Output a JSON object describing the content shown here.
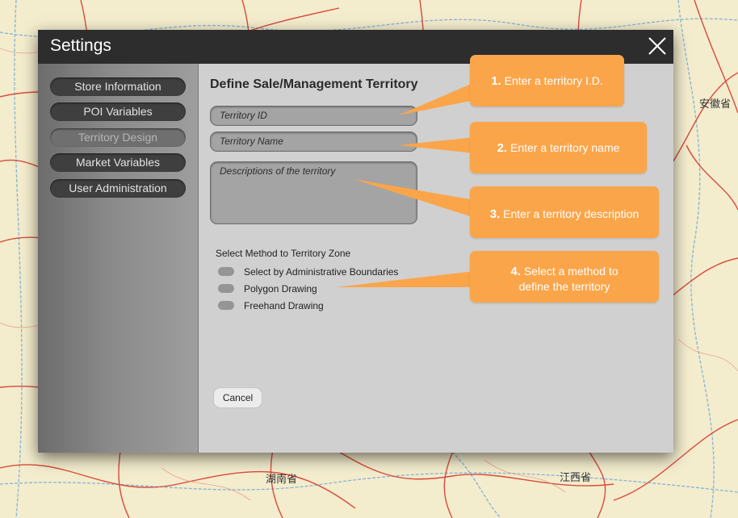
{
  "map": {
    "labels": [
      "安徽省",
      "湖南省",
      "江西省"
    ],
    "road_color": "#d63a2e",
    "boundary_color": "#6aa8d8",
    "background_color": "#f3eccd"
  },
  "dialog": {
    "title": "Settings",
    "close_icon": "close-x-icon",
    "sidebar": {
      "items": [
        {
          "label": "Store Information",
          "active": false
        },
        {
          "label": "POI Variables",
          "active": false
        },
        {
          "label": "Territory Design",
          "active": true
        },
        {
          "label": "Market Variables",
          "active": false
        },
        {
          "label": "User Administration",
          "active": false
        }
      ]
    },
    "main": {
      "heading": "Define Sale/Management Territory",
      "territory_id_placeholder": "Territory ID",
      "territory_name_placeholder": "Territory Name",
      "description_placeholder": "Descriptions of the territory",
      "method_title": "Select Method to Territory Zone",
      "methods": [
        {
          "label": "Select by Administrative Boundaries"
        },
        {
          "label": "Polygon Drawing"
        },
        {
          "label": "Freehand Drawing"
        }
      ],
      "cancel_label": "Cancel"
    }
  },
  "callouts": [
    {
      "num": "1.",
      "text": "Enter a territory I.D."
    },
    {
      "num": "2.",
      "text": "Enter a territory name"
    },
    {
      "num": "3.",
      "text": "Enter a territory description"
    },
    {
      "num": "4.",
      "text": "Select a method to define the territory"
    }
  ],
  "colors": {
    "callout": "#fba54a",
    "titlebar": "#2d2d2d",
    "nav_button": "#3f3f3f"
  }
}
